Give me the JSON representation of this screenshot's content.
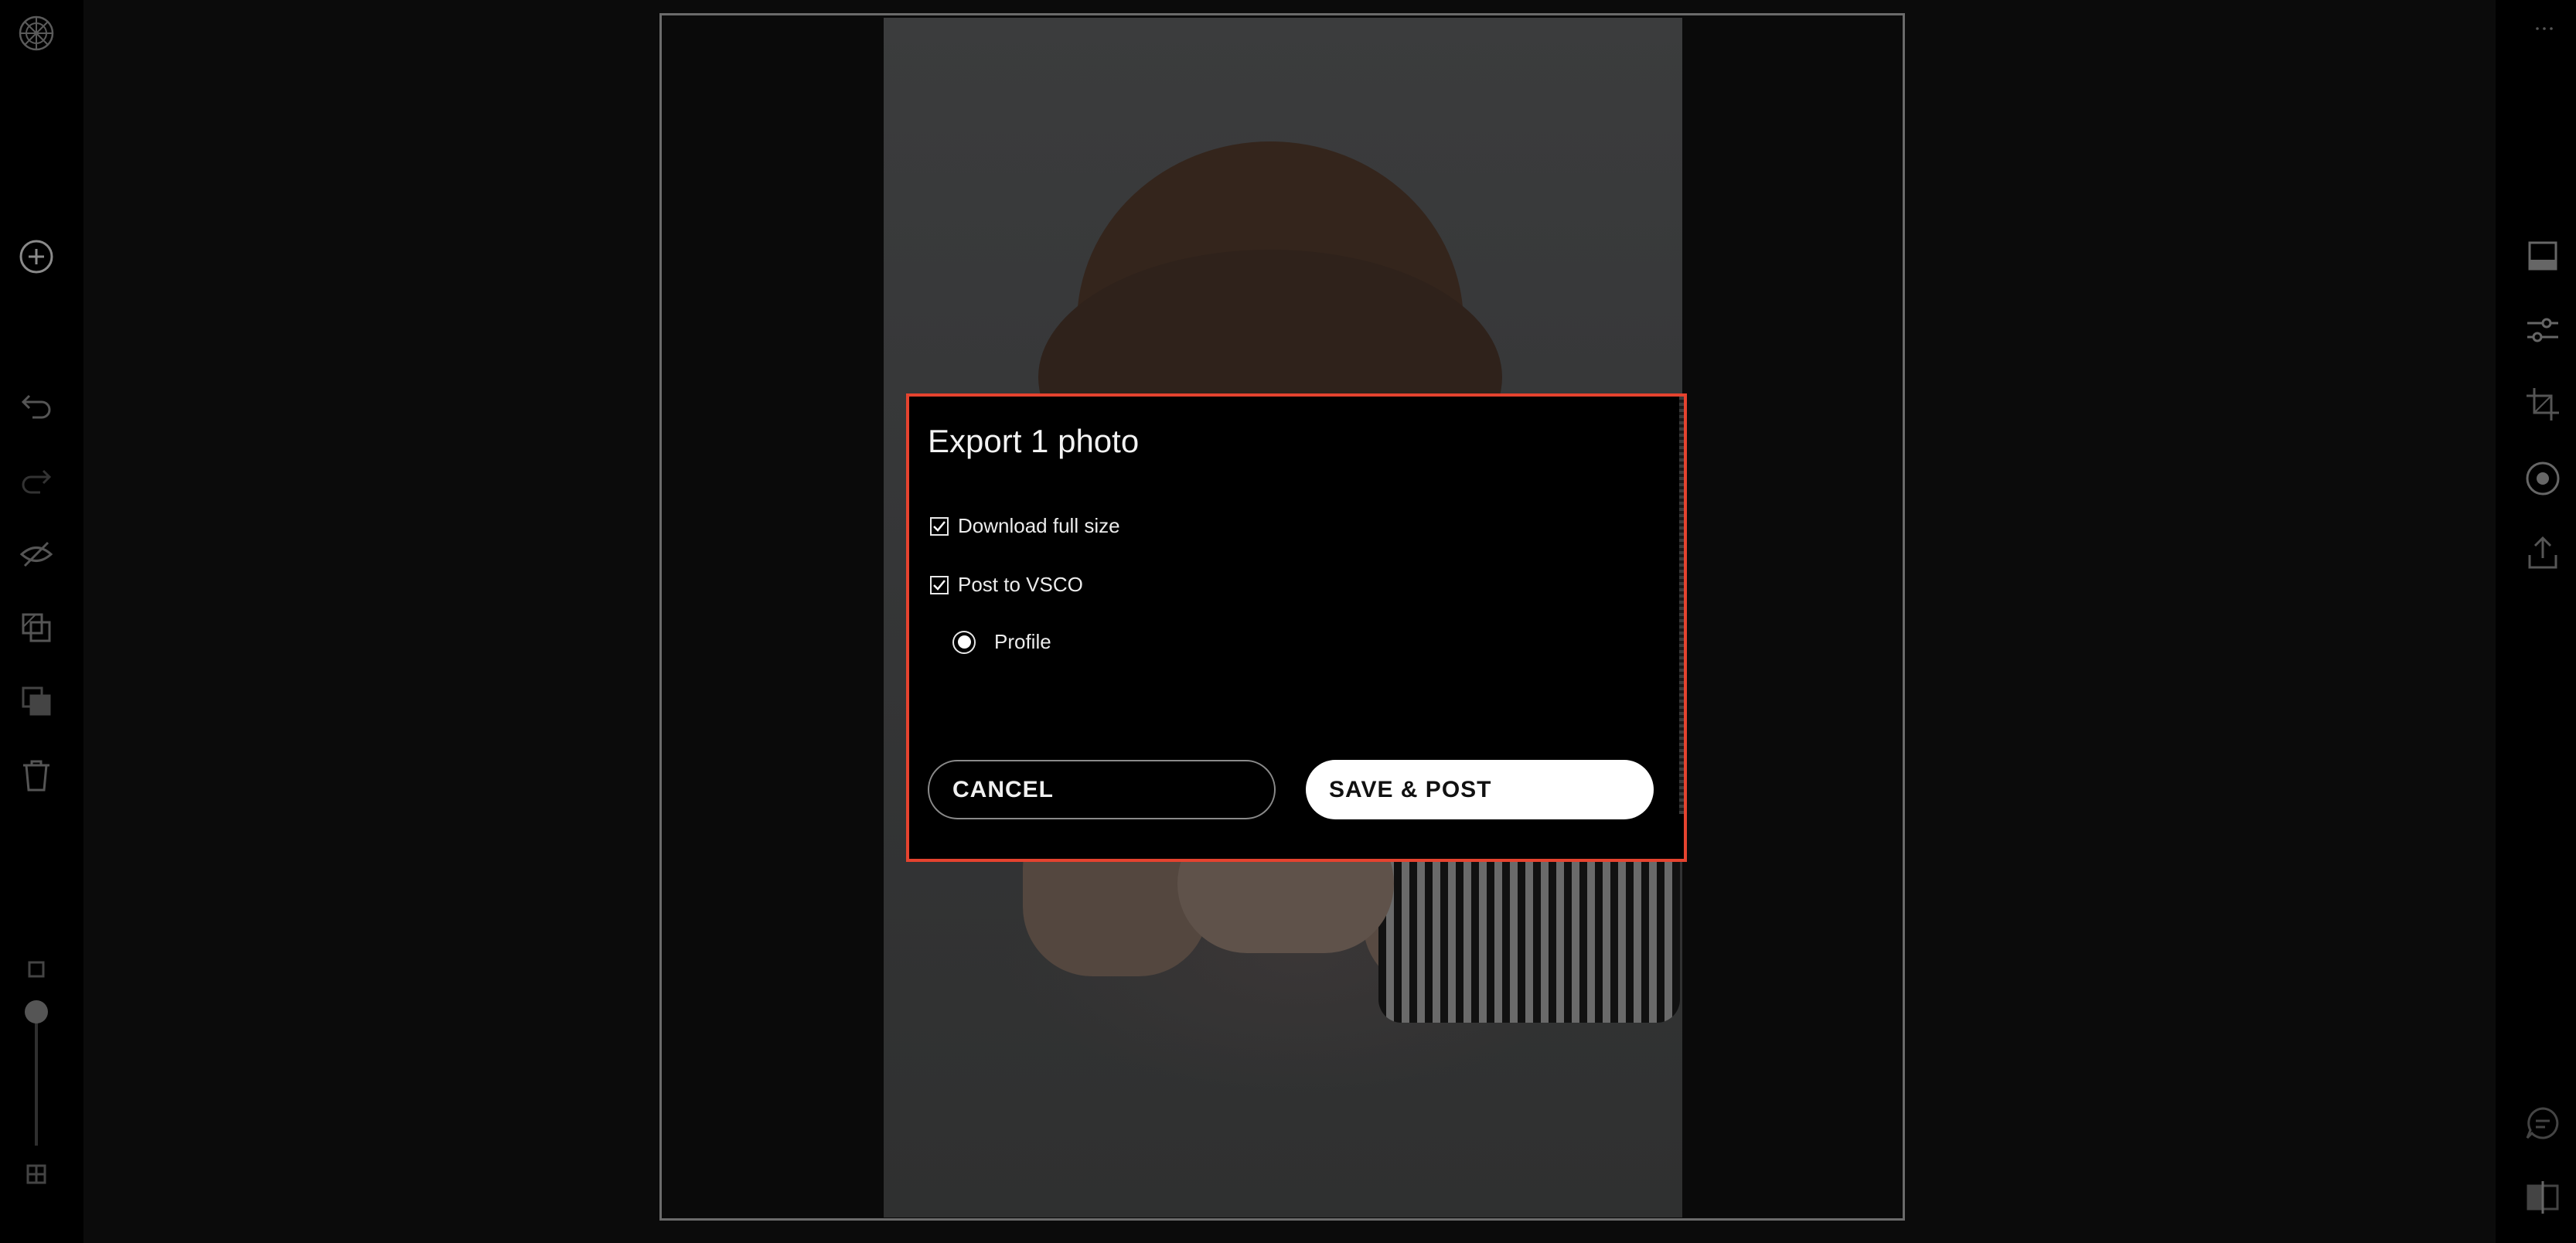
{
  "dialog": {
    "title": "Export 1 photo",
    "options": {
      "download_full_size": {
        "label": "Download full size",
        "checked": true
      },
      "post_to_vsco": {
        "label": "Post to VSCO",
        "checked": true
      }
    },
    "destination": {
      "label": "Profile",
      "selected": true
    },
    "cancel_label": "CANCEL",
    "save_label": "SAVE & POST"
  },
  "left_toolbar": {
    "icons": [
      "vsco-logo-icon",
      "add-icon",
      "undo-icon",
      "redo-icon",
      "hide-icon",
      "copy-edits-icon",
      "paste-edits-icon",
      "trash-icon",
      "grid-small-icon",
      "zoom-slider",
      "grid-large-icon"
    ]
  },
  "right_toolbar": {
    "icons": [
      "more-icon",
      "presets-icon",
      "adjust-icon",
      "crop-icon",
      "recipe-icon",
      "export-icon",
      "comment-icon",
      "compare-icon"
    ]
  },
  "colors": {
    "dialog_border": "#e5432f",
    "dialog_bg": "#000000",
    "save_button_bg": "#ffffff",
    "app_bg": "#0b0b0b"
  }
}
